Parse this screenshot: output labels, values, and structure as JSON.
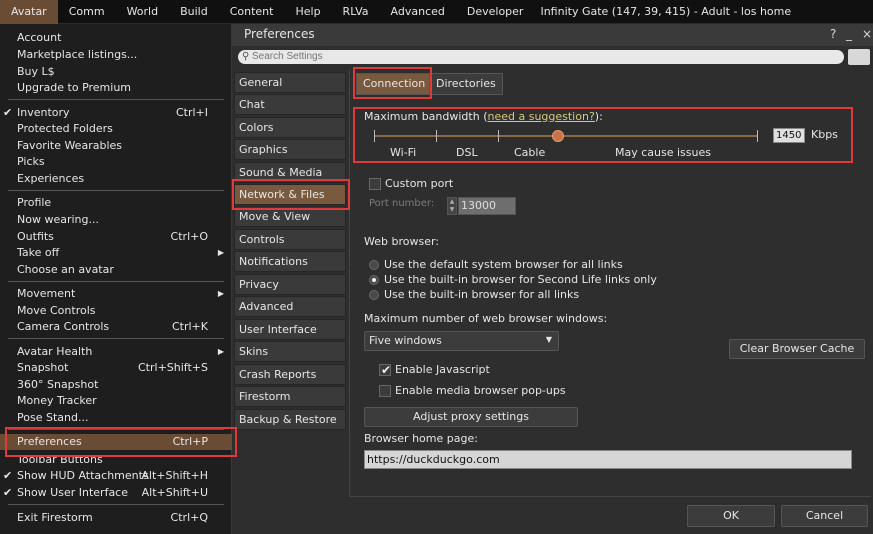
{
  "menubar": {
    "items": [
      "Avatar",
      "Comm",
      "World",
      "Build",
      "Content",
      "Help",
      "RLVa",
      "Advanced",
      "Developer"
    ],
    "location": "Infinity Gate (147, 39, 415) - Adult - los home"
  },
  "avatar_menu": {
    "items": [
      {
        "label": "Account",
        "shortcut": "",
        "check": false
      },
      {
        "label": "Marketplace listings...",
        "shortcut": "",
        "check": false
      },
      {
        "label": "Buy L$",
        "shortcut": "",
        "check": false
      },
      {
        "label": "Upgrade to Premium",
        "shortcut": "",
        "check": false
      },
      {
        "label": "Inventory",
        "shortcut": "Ctrl+I",
        "check": true
      },
      {
        "label": "Protected Folders",
        "shortcut": "",
        "check": false
      },
      {
        "label": "Favorite Wearables",
        "shortcut": "",
        "check": false
      },
      {
        "label": "Picks",
        "shortcut": "",
        "check": false
      },
      {
        "label": "Experiences",
        "shortcut": "",
        "check": false
      },
      {
        "label": "Profile",
        "shortcut": "",
        "check": false
      },
      {
        "label": "Now wearing...",
        "shortcut": "",
        "check": false
      },
      {
        "label": "Outfits",
        "shortcut": "Ctrl+O",
        "check": false
      },
      {
        "label": "Take off",
        "shortcut": "",
        "check": false,
        "submenu": true
      },
      {
        "label": "Choose an avatar",
        "shortcut": "",
        "check": false
      },
      {
        "label": "Movement",
        "shortcut": "",
        "check": false,
        "submenu": true
      },
      {
        "label": "Move Controls",
        "shortcut": "",
        "check": false
      },
      {
        "label": "Camera Controls",
        "shortcut": "Ctrl+K",
        "check": false
      },
      {
        "label": "Avatar Health",
        "shortcut": "",
        "check": false,
        "submenu": true
      },
      {
        "label": "Snapshot",
        "shortcut": "Ctrl+Shift+S",
        "check": false
      },
      {
        "label": "360° Snapshot",
        "shortcut": "",
        "check": false
      },
      {
        "label": "Money Tracker",
        "shortcut": "",
        "check": false
      },
      {
        "label": "Pose Stand...",
        "shortcut": "",
        "check": false
      },
      {
        "label": "Preferences",
        "shortcut": "Ctrl+P",
        "check": false,
        "highlight": true
      },
      {
        "label": "Toolbar Buttons",
        "shortcut": "",
        "check": false
      },
      {
        "label": "Show HUD Attachments",
        "shortcut": "Alt+Shift+H",
        "check": true
      },
      {
        "label": "Show User Interface",
        "shortcut": "Alt+Shift+U",
        "check": true
      },
      {
        "label": "Exit Firestorm",
        "shortcut": "Ctrl+Q",
        "check": false
      }
    ],
    "submenu_arrow": "▶",
    "checkmark": "✔"
  },
  "prefs": {
    "title": "Preferences",
    "help": "?",
    "minimize": "_",
    "close": "×",
    "search_placeholder": "Search Settings",
    "search_icon": "magnifier-icon",
    "categories": [
      "General",
      "Chat",
      "Colors",
      "Graphics",
      "Sound & Media",
      "Network & Files",
      "Move & View",
      "Controls",
      "Notifications",
      "Privacy",
      "Advanced",
      "User Interface",
      "Skins",
      "Crash Reports",
      "Firestorm",
      "Backup & Restore"
    ],
    "selected_category": "Network & Files",
    "tabs": [
      "Connection",
      "Directories"
    ],
    "selected_tab": "Connection",
    "bandwidth": {
      "label_prefix": "Maximum bandwidth (",
      "label_link": "need a suggestion?",
      "label_suffix": "):",
      "value": "1450",
      "unit": "Kbps",
      "slider_fraction": 0.48,
      "ticks": [
        "Wi-Fi",
        "DSL",
        "Cable",
        "May cause issues"
      ]
    },
    "custom_port": {
      "label": "Custom port",
      "checked": false,
      "port_label": "Port number:",
      "port_value": "13000"
    },
    "web_browser": {
      "label": "Web browser:",
      "options": [
        "Use the default system browser for all links",
        "Use the built-in browser for Second Life links only",
        "Use the built-in browser for all links"
      ],
      "selected_index": 1
    },
    "max_windows": {
      "label": "Maximum number of web browser windows:",
      "value": "Five windows"
    },
    "clear_cache": "Clear Browser Cache",
    "enable_js": {
      "label": "Enable Javascript",
      "checked": true
    },
    "enable_popups": {
      "label": "Enable media browser pop-ups",
      "checked": false
    },
    "proxy_button": "Adjust proxy settings",
    "home_page": {
      "label": "Browser home page:",
      "value": "https://duckduckgo.com"
    },
    "ok": "OK",
    "cancel": "Cancel"
  }
}
